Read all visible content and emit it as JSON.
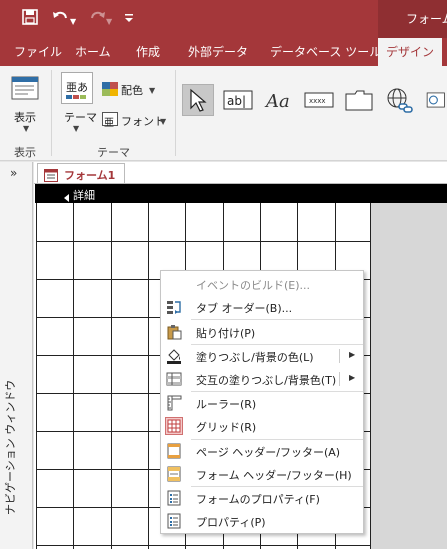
{
  "window": {
    "title": "フォーム"
  },
  "qat": {
    "save_icon": "save-icon",
    "undo_icon": "undo-icon",
    "redo_icon": "redo-icon",
    "customize_icon": "customize-qat-icon"
  },
  "ribbon_tabs": [
    {
      "label": "ファイル"
    },
    {
      "label": "ホーム"
    },
    {
      "label": "作成"
    },
    {
      "label": "外部データ"
    },
    {
      "label": "データベース ツール"
    },
    {
      "label": "デザイン",
      "active": true
    }
  ],
  "ribbon": {
    "view_label": "表示",
    "view_group": "表示",
    "theme_label": "テーマ",
    "colors_label": "配色",
    "fonts_label": "フォント",
    "theme_group": "テーマ"
  },
  "nav_pane": {
    "chevron": "»",
    "title": "ナビゲーション ウィンドウ"
  },
  "document": {
    "tab_label": "フォーム1",
    "section_label": "詳細"
  },
  "context_menu": {
    "items": [
      {
        "label": "イベントのビルド(E)...",
        "enabled": false
      },
      {
        "label": "タブ オーダー(B)...",
        "enabled": true
      },
      {
        "label": "貼り付け(P)",
        "enabled": true
      },
      {
        "label": "塗りつぶし/背景の色(L)",
        "enabled": true,
        "submenu": true
      },
      {
        "label": "交互の塗りつぶし/背景色(T)",
        "enabled": true,
        "submenu": true
      },
      {
        "label": "ルーラー(R)",
        "enabled": true
      },
      {
        "label": "グリッド(R)",
        "enabled": true,
        "checked": true
      },
      {
        "label": "ページ ヘッダー/フッター(A)",
        "enabled": true
      },
      {
        "label": "フォーム ヘッダー/フッター(H)",
        "enabled": true
      },
      {
        "label": "フォームのプロパティ(F)",
        "enabled": true
      },
      {
        "label": "プロパティ(P)",
        "enabled": true
      }
    ]
  },
  "colors": {
    "accent": "#a4373a",
    "ribbon_bg": "#f3f3f3",
    "grid_line": "#222222"
  }
}
